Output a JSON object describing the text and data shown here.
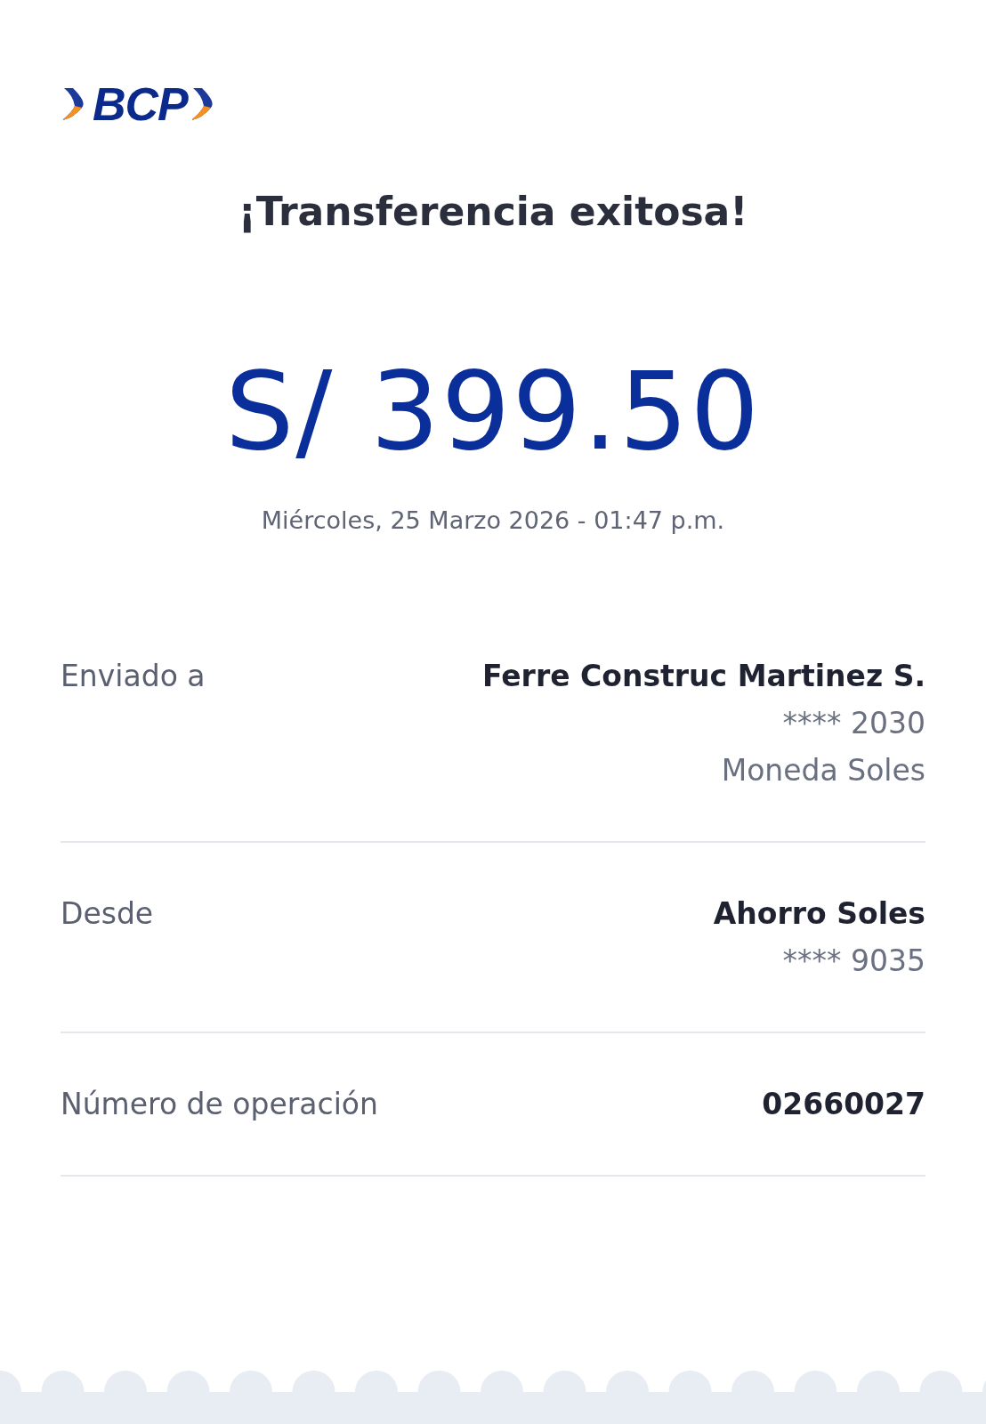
{
  "logo": {
    "text": "BCP"
  },
  "title": "¡Transferencia exitosa!",
  "amount": "S/ 399.50",
  "datetime": "Miércoles, 25 Marzo 2026 - 01:47 p.m.",
  "details": [
    {
      "label": "Enviado a",
      "value": "Ferre Construc Martinez S.",
      "extra": [
        "**** 2030",
        "Moneda Soles"
      ]
    },
    {
      "label": "Desde",
      "value": "Ahorro Soles",
      "extra": [
        "**** 9035"
      ]
    },
    {
      "label": "Número de operación",
      "value": "02660027"
    }
  ]
}
